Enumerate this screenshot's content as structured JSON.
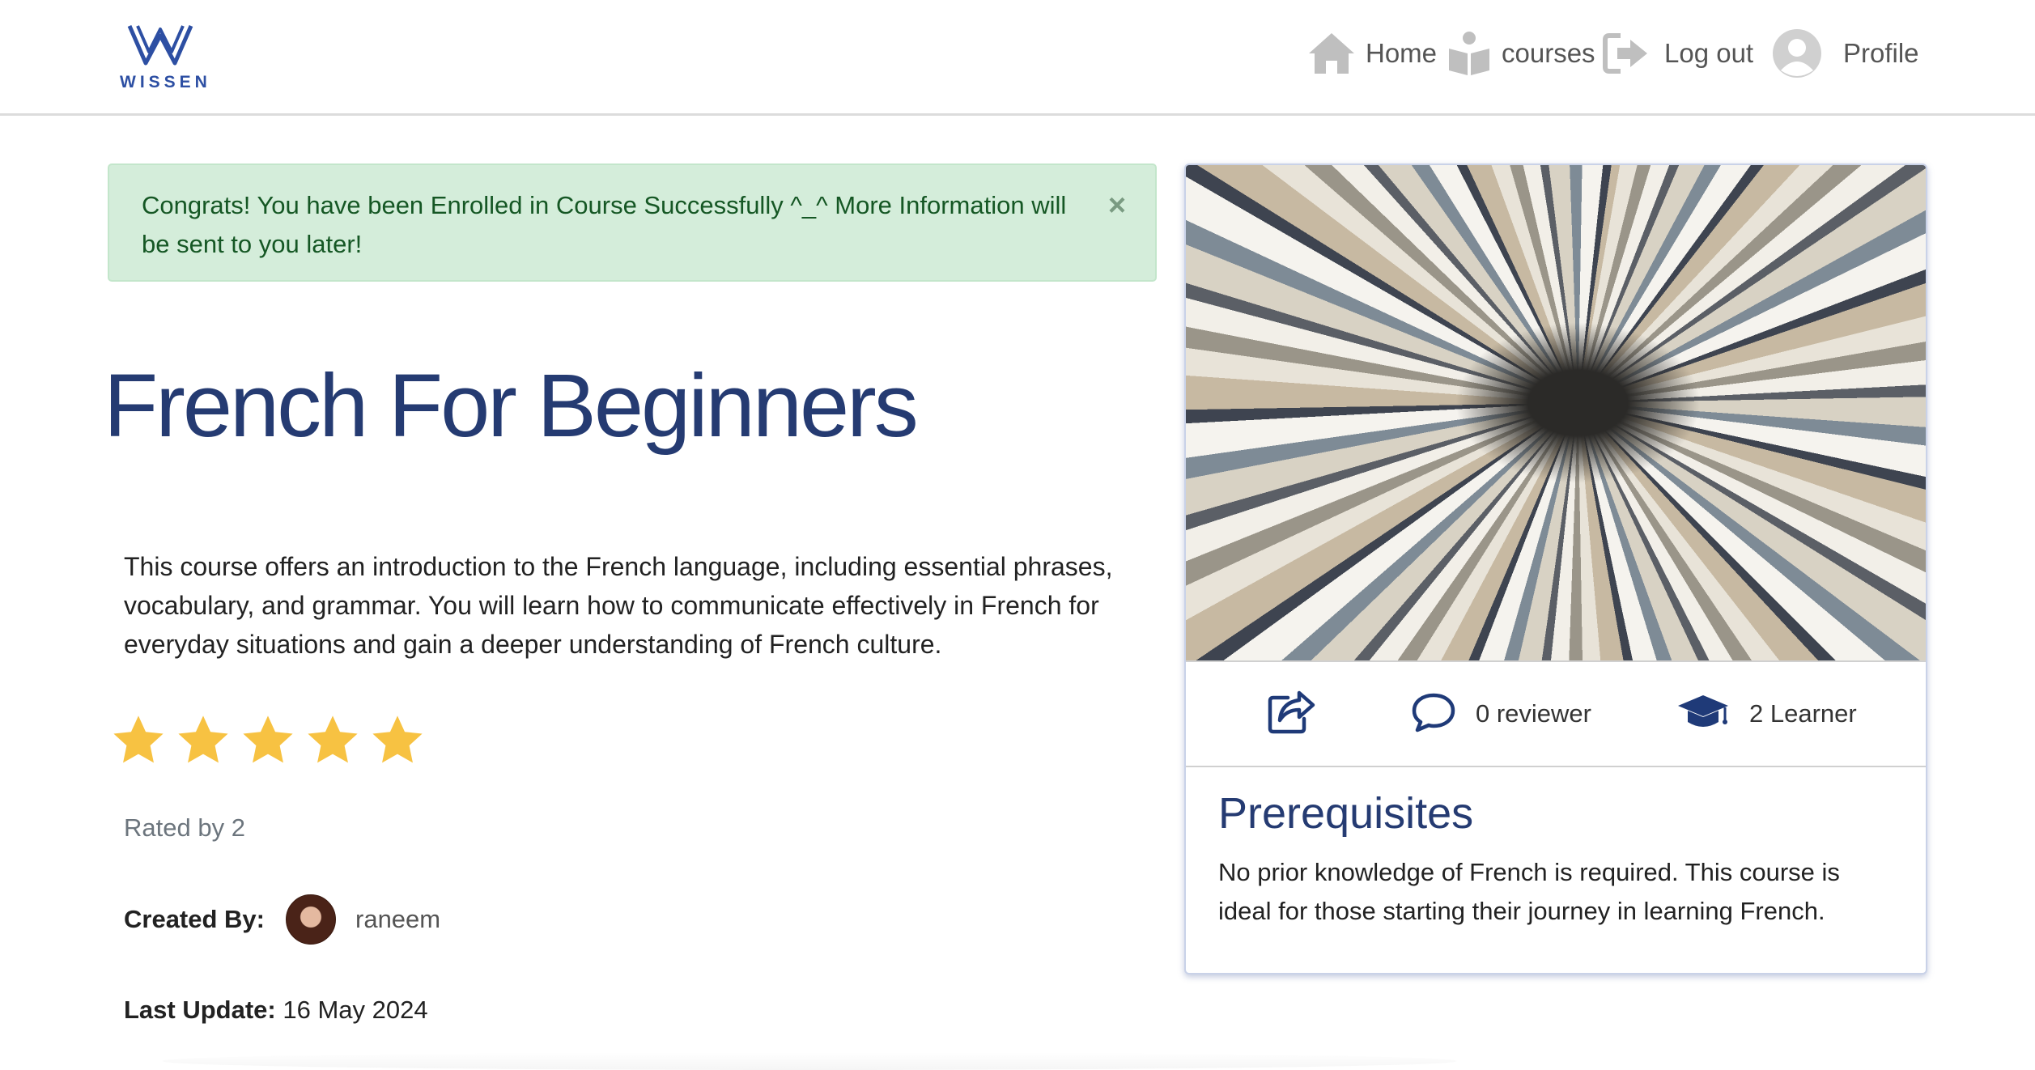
{
  "header": {
    "logo_text": "WISSEN",
    "nav": {
      "home": "Home",
      "courses": "courses",
      "logout": "Log out",
      "profile": "Profile"
    }
  },
  "alert": {
    "message": "Congrats! You have been Enrolled in Course Successfully ^_^ More Information will be sent to you later!",
    "close_symbol": "×"
  },
  "course": {
    "title": "French For Beginners",
    "description": "This course offers an introduction to the French language, including essential phrases, vocabulary, and grammar. You will learn how to communicate effectively in French for everyday situations and gain a deeper understanding of French culture.",
    "rating": {
      "value": 5,
      "max": 5
    },
    "rated_by": "Rated by 2",
    "created_by_label": "Created By:",
    "creator": "raneem",
    "last_update_label": "Last Update:",
    "last_update": "16 May 2024"
  },
  "card": {
    "reviewers": "0 reviewer",
    "learners": "2 Learner",
    "prereq_title": "Prerequisites",
    "prereq_text": "No prior knowledge of French is required. This course is ideal for those starting their journey in learning French."
  },
  "icons": {
    "home": "home-icon",
    "courses": "book-reader-icon",
    "logout": "sign-out-icon",
    "profile": "user-avatar-icon",
    "share": "share-icon",
    "comment": "comment-icon",
    "learner": "graduation-cap-icon",
    "star": "star-icon"
  },
  "colors": {
    "brand": "#253b72",
    "star": "#f7c242",
    "alert_bg": "#d4edda",
    "alert_text": "#155724"
  }
}
